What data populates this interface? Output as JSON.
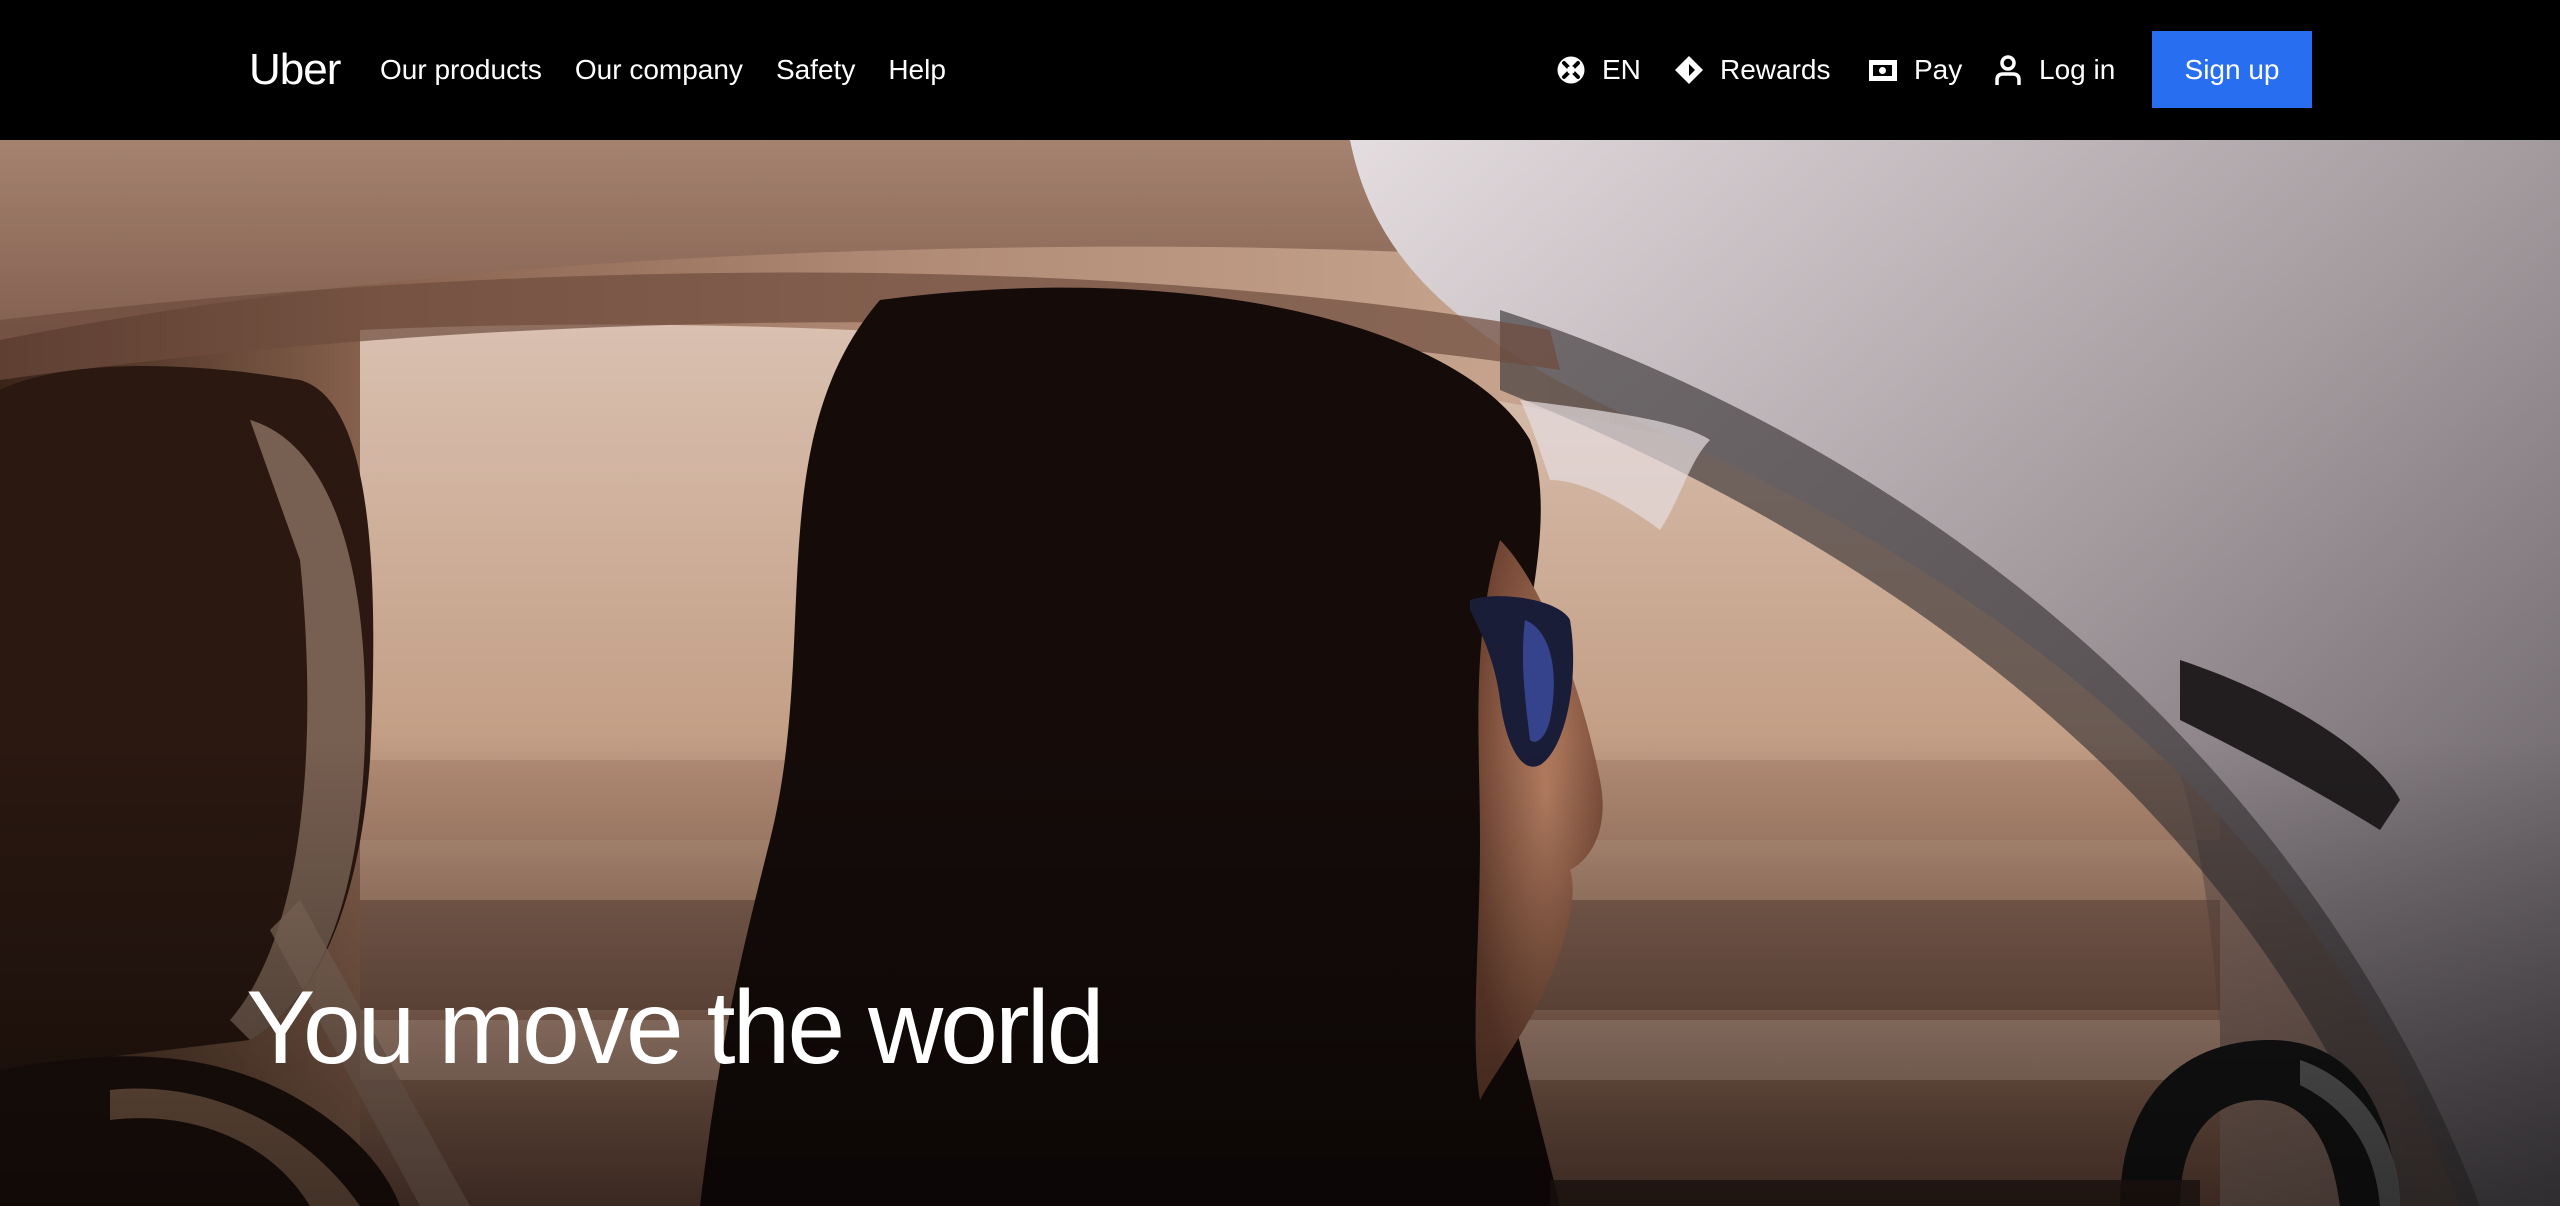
{
  "brand": {
    "logo_text": "Uber",
    "accent_color": "#276ef1"
  },
  "nav": {
    "left": [
      {
        "label": "Our products"
      },
      {
        "label": "Our company"
      },
      {
        "label": "Safety"
      },
      {
        "label": "Help"
      }
    ],
    "language": {
      "label": "EN",
      "icon": "globe-icon"
    },
    "rewards": {
      "label": "Rewards",
      "icon": "diamond-icon"
    },
    "pay": {
      "label": "Pay",
      "icon": "wallet-icon"
    },
    "login": {
      "label": "Log in",
      "icon": "user-icon"
    },
    "signup": {
      "label": "Sign up"
    }
  },
  "hero": {
    "title": "You move the world",
    "image": "woman-driving-car-photo"
  }
}
